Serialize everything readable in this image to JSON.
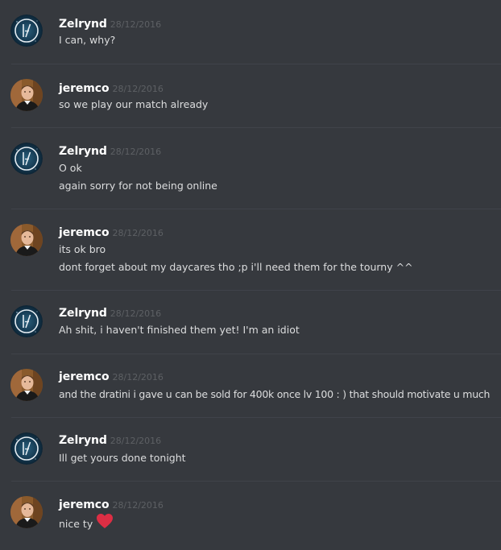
{
  "messages": [
    {
      "author": "Zelrynd",
      "avatar": "zelrynd-avatar",
      "timestamp": "28/12/2016",
      "lines": [
        "I can, why?"
      ]
    },
    {
      "author": "jeremco",
      "avatar": "jeremco-avatar",
      "timestamp": "28/12/2016",
      "lines": [
        "so we play our match already"
      ]
    },
    {
      "author": "Zelrynd",
      "avatar": "zelrynd-avatar",
      "timestamp": "28/12/2016",
      "lines": [
        "O ok",
        "again sorry for not being online"
      ]
    },
    {
      "author": "jeremco",
      "avatar": "jeremco-avatar",
      "timestamp": "28/12/2016",
      "lines": [
        "its ok bro",
        "dont forget about my daycares tho ;p i'll need them for the tourny ^^"
      ]
    },
    {
      "author": "Zelrynd",
      "avatar": "zelrynd-avatar",
      "timestamp": "28/12/2016",
      "lines": [
        "Ah shit, i haven't finished them yet! I'm an idiot"
      ]
    },
    {
      "author": "jeremco",
      "avatar": "jeremco-avatar",
      "timestamp": "28/12/2016",
      "lines": [
        "and the dratini i gave u can be sold for 400k once lv 100 : ) that should motivate u much"
      ]
    },
    {
      "author": "Zelrynd",
      "avatar": "zelrynd-avatar",
      "timestamp": "28/12/2016",
      "lines": [
        "Ill get yours done tonight"
      ]
    },
    {
      "author": "jeremco",
      "avatar": "jeremco-avatar",
      "timestamp": "28/12/2016",
      "lines": [
        "nice ty"
      ],
      "emoji": "heart-icon",
      "emoji_color": "#dd2e44"
    }
  ],
  "colors": {
    "background": "#36393e",
    "username": "#ffffff",
    "text": "#dcddde",
    "timestamp": "#5d6064",
    "divider": "#40434a"
  }
}
